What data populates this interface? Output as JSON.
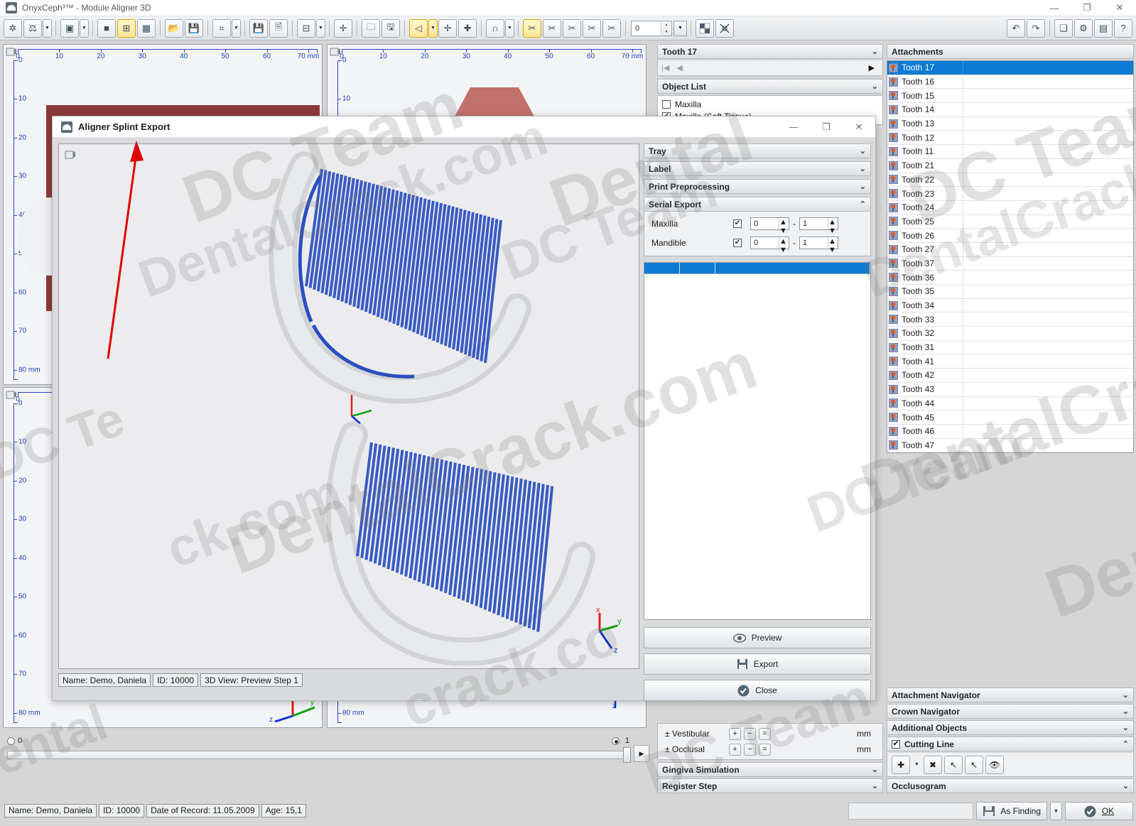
{
  "window": {
    "title": "OnyxCeph³™ - Module Aligner 3D",
    "app_icon": "onyx-logo-icon",
    "minimize": "—",
    "maximize": "❐",
    "close": "✕"
  },
  "toolbar": {
    "groups": [
      {
        "buttons": [
          {
            "name": "asterisk-tool",
            "glyph": "✲",
            "selected": false,
            "caret": false
          },
          {
            "name": "articulator-tool",
            "glyph": "⚖",
            "selected": false,
            "caret": true
          }
        ]
      },
      {
        "buttons": [
          {
            "name": "3d-cube-tool",
            "glyph": "▣",
            "selected": false,
            "caret": true
          }
        ]
      },
      {
        "buttons": [
          {
            "name": "single-view-layout",
            "glyph": "■",
            "selected": false,
            "caret": false
          },
          {
            "name": "quad-view-layout",
            "glyph": "⊞",
            "selected": true,
            "caret": false
          },
          {
            "name": "grid-view-layout",
            "glyph": "▦",
            "selected": false,
            "caret": false
          }
        ]
      },
      {
        "buttons": [
          {
            "name": "open-file-tool",
            "glyph": "📂",
            "selected": false,
            "caret": false
          },
          {
            "name": "save-file-tool",
            "glyph": "💾",
            "selected": false,
            "caret": false
          }
        ]
      },
      {
        "buttons": [
          {
            "name": "frame-tool",
            "glyph": "⌗",
            "selected": false,
            "caret": true
          }
        ]
      },
      {
        "buttons": [
          {
            "name": "save-preview-tool",
            "glyph": "💾",
            "selected": false,
            "caret": false
          },
          {
            "name": "document-add-tool",
            "glyph": "🗎",
            "selected": false,
            "caret": false
          }
        ]
      },
      {
        "buttons": [
          {
            "name": "tooth-grid-tool",
            "glyph": "⊟",
            "selected": false,
            "caret": true
          }
        ]
      },
      {
        "buttons": [
          {
            "name": "crosshair-tool",
            "glyph": "✛",
            "selected": false,
            "caret": false
          }
        ]
      },
      {
        "buttons": [
          {
            "name": "folder-model-tool",
            "glyph": "🗀",
            "selected": false,
            "caret": false
          },
          {
            "name": "save-model-tool",
            "glyph": "🖫",
            "selected": false,
            "caret": false
          }
        ]
      },
      {
        "buttons": [
          {
            "name": "cut-region-tool",
            "glyph": "◁",
            "selected": true,
            "caret": true
          },
          {
            "name": "add-point-tool",
            "glyph": "✛",
            "selected": false,
            "caret": false
          },
          {
            "name": "add-help-point-tool",
            "glyph": "✚",
            "selected": false,
            "caret": false
          }
        ]
      },
      {
        "buttons": [
          {
            "name": "magnet-snap-tool",
            "glyph": "∩",
            "selected": false,
            "caret": true
          }
        ]
      },
      {
        "buttons": [
          {
            "name": "cut-free-tool",
            "glyph": "✂",
            "selected": true,
            "caret": false
          },
          {
            "name": "cut-x-tool",
            "glyph": "✂",
            "selected": false,
            "caret": false
          },
          {
            "name": "cut-y-tool",
            "glyph": "✂",
            "selected": false,
            "caret": false
          },
          {
            "name": "cut-z-tool",
            "glyph": "✂",
            "selected": false,
            "caret": false
          },
          {
            "name": "cut-curve-tool",
            "glyph": "✂",
            "selected": false,
            "caret": false
          }
        ]
      }
    ],
    "cut_value": "0",
    "checker_tool": "checker-pattern-tool",
    "measure_tool": "measure-tool",
    "right_buttons": [
      {
        "name": "undo-button",
        "glyph": "↶"
      },
      {
        "name": "redo-button",
        "glyph": "↷"
      },
      {
        "name": "image-layers-button",
        "glyph": "❏"
      },
      {
        "name": "settings-gear-button",
        "glyph": "⚙"
      },
      {
        "name": "more-options-button",
        "glyph": "▤"
      },
      {
        "name": "help-button",
        "glyph": "?"
      }
    ]
  },
  "rulers": {
    "unit": "mm",
    "h_ticks": [
      "0",
      "10",
      "20",
      "30",
      "40",
      "50",
      "60",
      "70 mm"
    ],
    "v_ticks": [
      "0",
      "10",
      "20",
      "30",
      "40",
      "50",
      "60",
      "70",
      "80 mm"
    ]
  },
  "tooth_panel": {
    "title": "Tooth 17",
    "nav_first": "|◀",
    "nav_prev": "◀",
    "nav_next": "▶"
  },
  "object_list": {
    "title": "Object List",
    "items": [
      {
        "label": "Maxilla",
        "checked": false
      },
      {
        "label": "Maxilla (Soft Tissue)",
        "checked": true
      }
    ]
  },
  "dialog": {
    "title": "Aligner Splint Export",
    "minimize": "—",
    "maximize": "❐",
    "close": "✕",
    "sections": [
      {
        "name": "tray",
        "label": "Tray",
        "expanded": false
      },
      {
        "name": "label",
        "label": "Label",
        "expanded": false
      },
      {
        "name": "print-preprocessing",
        "label": "Print Preprocessing",
        "expanded": false
      },
      {
        "name": "serial-export",
        "label": "Serial Export",
        "expanded": true
      }
    ],
    "serial_export": {
      "rows": [
        {
          "label": "Maxilla",
          "checked": true,
          "from": "0",
          "to": "1"
        },
        {
          "label": "Mandible",
          "checked": true,
          "from": "0",
          "to": "1"
        }
      ],
      "separator": "-",
      "table_columns": [
        "",
        "",
        ""
      ],
      "table_rows": []
    },
    "buttons": [
      {
        "name": "preview-button",
        "label": "Preview",
        "icon": "eye-icon"
      },
      {
        "name": "export-button",
        "label": "Export",
        "icon": "floppy-disk-icon"
      },
      {
        "name": "close-button",
        "label": "Close",
        "icon": "check-circle-icon"
      }
    ],
    "status": [
      "Name: Demo, Daniela",
      "ID: 10000",
      "3D View: Preview Step 1"
    ],
    "axis_labels": [
      "X",
      "Y",
      "Z"
    ]
  },
  "attachments": {
    "title": "Attachments",
    "items": [
      {
        "label": "Tooth 17",
        "selected": true
      },
      {
        "label": "Tooth 16",
        "selected": false
      },
      {
        "label": "Tooth 15",
        "selected": false
      },
      {
        "label": "Tooth 14",
        "selected": false
      },
      {
        "label": "Tooth 13",
        "selected": false
      },
      {
        "label": "Tooth 12",
        "selected": false
      },
      {
        "label": "Tooth 11",
        "selected": false
      },
      {
        "label": "Tooth 21",
        "selected": false
      },
      {
        "label": "Tooth 22",
        "selected": false
      },
      {
        "label": "Tooth 23",
        "selected": false
      },
      {
        "label": "Tooth 24",
        "selected": false
      },
      {
        "label": "Tooth 25",
        "selected": false
      },
      {
        "label": "Tooth 26",
        "selected": false
      },
      {
        "label": "Tooth 27",
        "selected": false
      },
      {
        "label": "Tooth 37",
        "selected": false
      },
      {
        "label": "Tooth 36",
        "selected": false
      },
      {
        "label": "Tooth 35",
        "selected": false
      },
      {
        "label": "Tooth 34",
        "selected": false
      },
      {
        "label": "Tooth 33",
        "selected": false
      },
      {
        "label": "Tooth 32",
        "selected": false
      },
      {
        "label": "Tooth 31",
        "selected": false
      },
      {
        "label": "Tooth 41",
        "selected": false
      },
      {
        "label": "Tooth 42",
        "selected": false
      },
      {
        "label": "Tooth 43",
        "selected": false
      },
      {
        "label": "Tooth 44",
        "selected": false
      },
      {
        "label": "Tooth 45",
        "selected": false
      },
      {
        "label": "Tooth 46",
        "selected": false
      },
      {
        "label": "Tooth 47",
        "selected": false
      }
    ]
  },
  "right_sections": [
    {
      "name": "attachment-navigator",
      "label": "Attachment Navigator",
      "expanded": false,
      "checkbox": false
    },
    {
      "name": "crown-navigator",
      "label": "Crown Navigator",
      "expanded": false,
      "checkbox": false
    },
    {
      "name": "additional-objects",
      "label": "Additional Objects",
      "expanded": false,
      "checkbox": false
    },
    {
      "name": "cutting-line",
      "label": "Cutting Line",
      "expanded": true,
      "checkbox": true,
      "checked": true
    },
    {
      "name": "occlusogram",
      "label": "Occlusogram",
      "expanded": false,
      "checkbox": false
    }
  ],
  "cutting_line_tools": [
    {
      "name": "add-cutting-line-button",
      "glyph": "✚",
      "caret": true
    },
    {
      "name": "delete-cutting-line-button",
      "glyph": "✖",
      "caret": false
    },
    {
      "name": "add-point-cursor-button",
      "glyph": "↖",
      "caret": false
    },
    {
      "name": "remove-point-cursor-button",
      "glyph": "↖",
      "caret": false
    },
    {
      "name": "toggle-visibility-button",
      "glyph": "👁",
      "caret": false
    }
  ],
  "offsets_panel": {
    "rows": [
      {
        "label": "± Vestibular",
        "unit": "mm",
        "buttons": [
          "+",
          "−",
          "="
        ]
      },
      {
        "label": "± Occlusal",
        "unit": "mm",
        "buttons": [
          "+",
          "−",
          "="
        ]
      }
    ]
  },
  "lower_sections": [
    {
      "name": "gingiva-simulation",
      "label": "Gingiva Simulation",
      "expanded": false
    },
    {
      "name": "register-step",
      "label": "Register Step",
      "expanded": false
    }
  ],
  "timeline": {
    "start_label": "0",
    "end_label": "1",
    "start_selected": false,
    "end_selected": true,
    "play_glyph": "▶"
  },
  "statusbar": {
    "cells": [
      "Name: Demo, Daniela",
      "ID: 10000",
      "Date of Record: 11.05.2009",
      "Age: 15,1"
    ]
  },
  "footer": {
    "as_finding_label": "As Finding",
    "as_finding_icon": "save-image-icon",
    "as_finding_caret": "▼",
    "ok_label": "OK",
    "ok_icon": "check-circle-icon"
  },
  "watermarks": [
    "DC Team",
    "DentalCrack.com",
    "Dental",
    "DC Team",
    "DentalCrack",
    "DC Team",
    "DentalCrack.com",
    "ck.com",
    "DC Te",
    "crack.co"
  ],
  "colors": {
    "accent_blue": "#0d7bd4",
    "selection_blue": "#0d7bd4",
    "ruler_blue": "#2b45c0",
    "model_red": "#8e3a3a",
    "aligner_blue": "#2a4fc0",
    "highlight_yellow": "#ffe796",
    "arrow_red": "#e00000"
  }
}
